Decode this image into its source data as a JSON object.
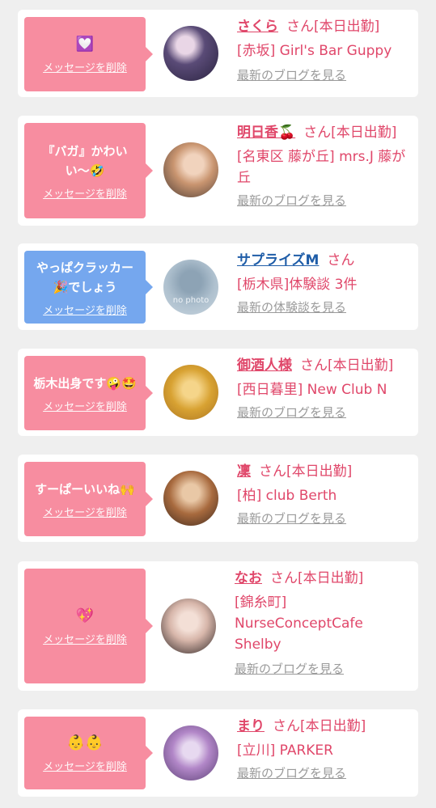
{
  "delete_label": "メッセージを削除",
  "cards": [
    {
      "message": "💟",
      "name": "さくら",
      "san": "さん",
      "status": "[本日出勤]",
      "shop": "[赤坂] Girl's Bar Guppy",
      "link": "最新のブログを見る"
    },
    {
      "message": "『バガ』かわいい〜🤣",
      "name": "明日香🍒",
      "san": "さん",
      "status": "[本日出勤]",
      "shop": "[名東区 藤が丘] mrs.J 藤が丘",
      "link": "最新のブログを見る"
    },
    {
      "message": "やっぱクラッカー🎉でしょう",
      "name": "サプライズM",
      "san": "さん",
      "status": "",
      "shop": "[栃木県]体験談 3件",
      "link": "最新の体験談を見る",
      "avatar_text": "no photo"
    },
    {
      "message": "栃木出身です🤪🤩",
      "name": "御酒人様",
      "san": "さん",
      "status": "[本日出勤]",
      "shop": "[西日暮里] New Club N",
      "link": "最新のブログを見る"
    },
    {
      "message": "すーぱーいいね🙌",
      "name": "凜",
      "san": "さん",
      "status": "[本日出勤]",
      "shop": "[柏] club Berth",
      "link": "最新のブログを見る"
    },
    {
      "message": "💖",
      "name": "なお",
      "san": "さん",
      "status": "[本日出勤]",
      "shop": "[錦糸町] NurseConceptCafe Shelby",
      "link": "最新のブログを見る"
    },
    {
      "message": "👶👶",
      "name": "まり",
      "san": "さん",
      "status": "[本日出勤]",
      "shop": "[立川] PARKER",
      "link": "最新のブログを見る"
    }
  ],
  "colors": {
    "pink_bubble": "#f78da0",
    "blue_bubble": "#75a7ee",
    "name_pink": "#e0476a",
    "name_blue": "#1f5da8",
    "link_gray": "#9a9a9a"
  }
}
